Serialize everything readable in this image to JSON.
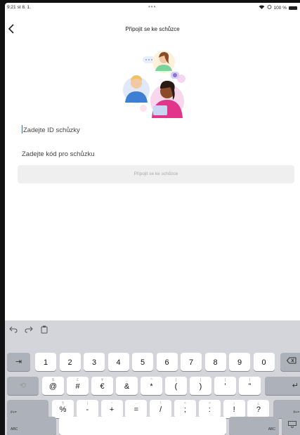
{
  "status": {
    "time": "9:21  st 8. 1.",
    "dots": "•••",
    "battery": "100 %"
  },
  "nav": {
    "title": "Připojit se ke schůzce"
  },
  "form": {
    "meeting_id_placeholder": "Zadejte ID schůzky",
    "passcode_placeholder": "Zadejte kód pro schůzku",
    "join_label": "Připojit se ke schůzce"
  },
  "keyboard": {
    "row1": [
      {
        "main": "1",
        "small": ""
      },
      {
        "main": "2",
        "small": ""
      },
      {
        "main": "3",
        "small": ""
      },
      {
        "main": "4",
        "small": ""
      },
      {
        "main": "5",
        "small": ""
      },
      {
        "main": "6",
        "small": ""
      },
      {
        "main": "7",
        "small": ""
      },
      {
        "main": "8",
        "small": ""
      },
      {
        "main": "9",
        "small": ""
      },
      {
        "main": "0",
        "small": ""
      }
    ],
    "row2": [
      {
        "main": "@",
        "small": "$"
      },
      {
        "main": "#",
        "small": "£"
      },
      {
        "main": "€",
        "small": "¥"
      },
      {
        "main": "&",
        "small": "_"
      },
      {
        "main": "*",
        "small": "^"
      },
      {
        "main": "(",
        "small": "["
      },
      {
        "main": ")",
        "small": "]"
      },
      {
        "main": "’",
        "small": "{"
      },
      {
        "main": "”",
        "small": "}"
      }
    ],
    "row3": [
      {
        "main": "%",
        "small": "§"
      },
      {
        "main": "-",
        "small": "|"
      },
      {
        "main": "+",
        "small": "~"
      },
      {
        "main": "=",
        "small": "…"
      },
      {
        "main": "/",
        "small": "\\"
      },
      {
        "main": ";",
        "small": "<"
      },
      {
        "main": ":",
        "small": ">"
      },
      {
        "main": "!",
        "small": "¡"
      },
      {
        "main": "?",
        "small": "¿"
      }
    ],
    "labels": {
      "shift_left": "#+=",
      "shift_right": "#+=",
      "abc_left": "ABC",
      "abc_right": "ABC"
    }
  }
}
